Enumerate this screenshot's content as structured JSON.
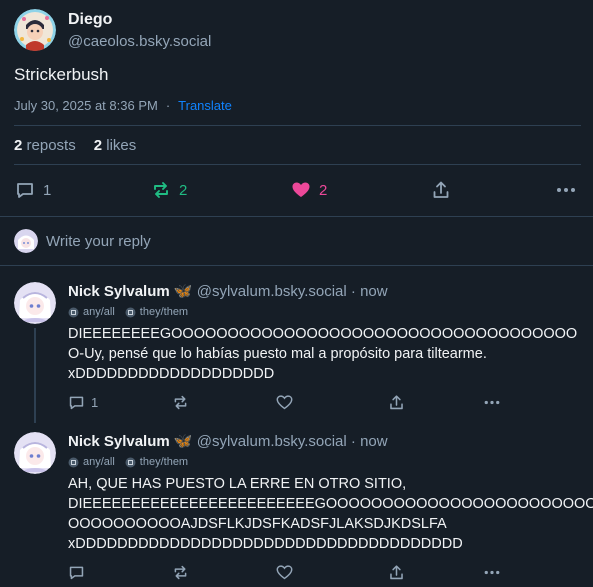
{
  "post": {
    "author_name": "Diego",
    "author_handle": "@caeolos.bsky.social",
    "text": "Strickerbush",
    "timestamp": "July 30, 2025 at 8:36 PM",
    "meta_sep": "·",
    "translate": "Translate",
    "reposts_count": "2",
    "reposts_label": "reposts",
    "likes_count": "2",
    "likes_label": "likes",
    "actions": {
      "reply_count": "1",
      "repost_count": "2",
      "like_count": "2"
    },
    "colors": {
      "repost_active": "#20bc83",
      "like_active": "#ec4899",
      "link": "#1083fe"
    }
  },
  "reply_box": {
    "placeholder": "Write your reply"
  },
  "replies": [
    {
      "name": "Nick Sylvalum",
      "emoji": "🦋",
      "handle": "@sylvalum.bsky.social",
      "time": "· now",
      "labels": [
        "any/all",
        "they/them"
      ],
      "lines": [
        "DIEEEEEEEEGOOOOOOOOOOOOOOOOOOOOOOOOOOOOOOOOOOOO",
        "O-Uy, pensé que lo habías puesto mal a propósito para tiltearme.",
        "xDDDDDDDDDDDDDDDDDDD"
      ],
      "reply_count": "1"
    },
    {
      "name": "Nick Sylvalum",
      "emoji": "🦋",
      "handle": "@sylvalum.bsky.social",
      "time": "· now",
      "labels": [
        "any/all",
        "they/them"
      ],
      "lines": [
        "AH, QUE HAS PUESTO LA ERRE EN OTRO SITIO,",
        "DIEEEEEEEEEEEEEEEEEEEEEEEEGOOOOOOOOOOOOOOOOOOOOOOOO",
        "OOOOOOOOOOAJDSFLKJDSFKADSFJLAKSDJKDSLFA",
        "xDDDDDDDDDDDDDDDDDDDDDDDDDDDDDDDDDDDDD"
      ],
      "reply_count": ""
    }
  ]
}
